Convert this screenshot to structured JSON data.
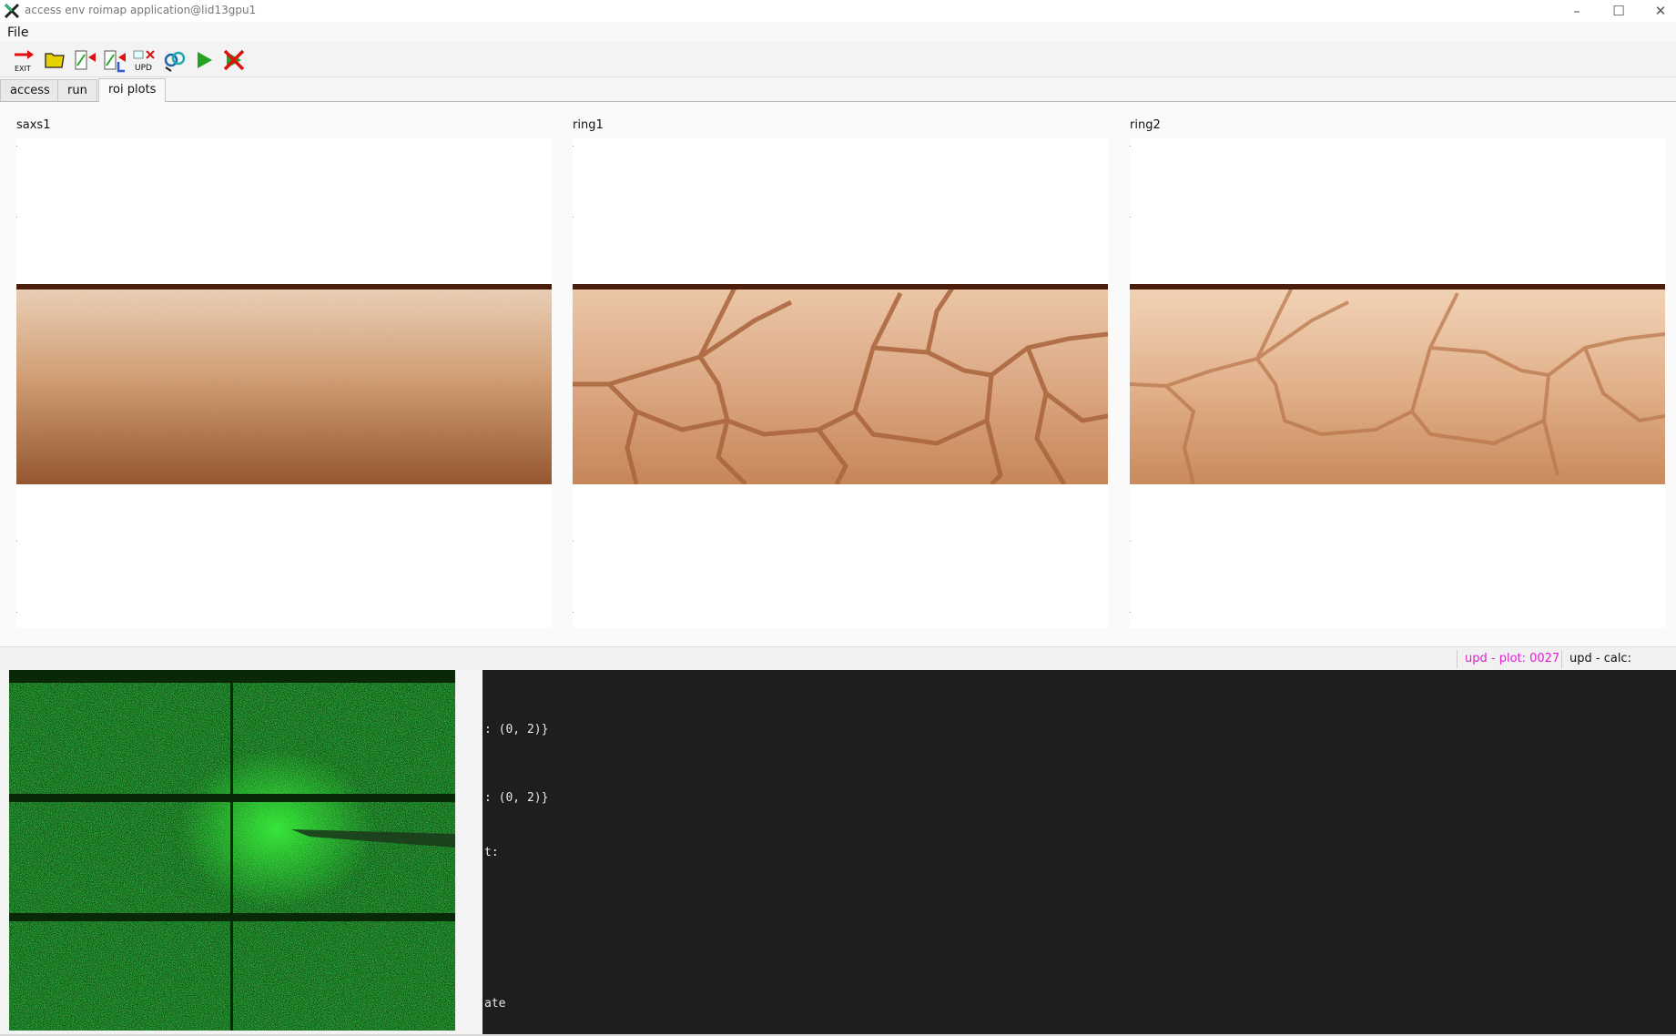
{
  "window": {
    "title": "access env roimap application@lid13gpu1"
  },
  "menu": {
    "file": "File"
  },
  "toolbar": {
    "exit_label": "EXIT",
    "upd_label": "UPD"
  },
  "tabs": [
    "access",
    "run",
    "roi plots"
  ],
  "plots": [
    {
      "label": "saxs1"
    },
    {
      "label": "ring1"
    },
    {
      "label": "ring2"
    }
  ],
  "status": {
    "plot": "upd - plot: 0027",
    "calc": "upd - calc:"
  },
  "terminal": {
    "lines": [
      ": (0, 2)}",
      ": (0, 2)}",
      "t:",
      "ate"
    ]
  },
  "colors": {
    "status_plot": "#e020d0",
    "terminal_bg": "#1e1e1e",
    "detector": "#1fa81f"
  }
}
